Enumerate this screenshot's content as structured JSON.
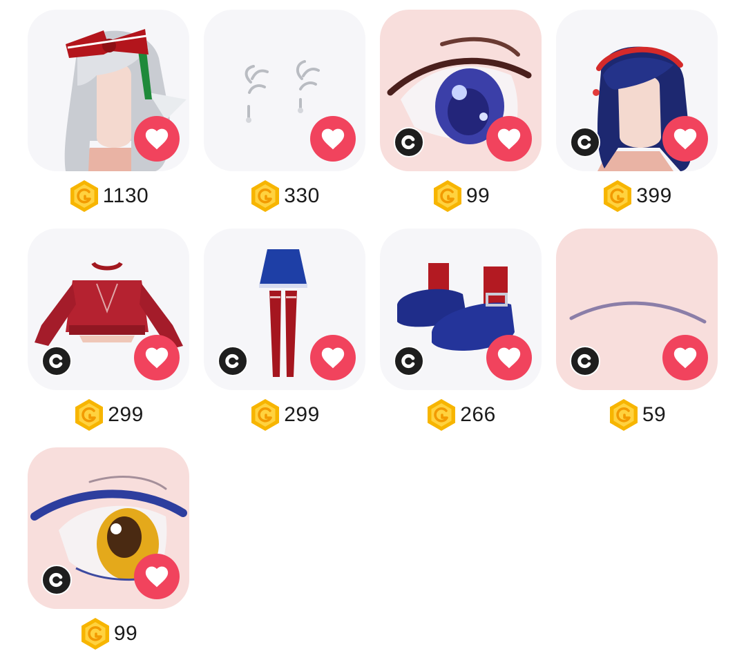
{
  "colors": {
    "heart": "#f1435d",
    "coin": "#f7b500",
    "badge": "#1e1e1e"
  },
  "items": [
    {
      "price": "1130",
      "thumbnail": "white-hair-with-red-bow",
      "creator_badge": false
    },
    {
      "price": "330",
      "thumbnail": "silver-antler-earrings",
      "creator_badge": false
    },
    {
      "price": "99",
      "thumbnail": "blue-eye",
      "creator_badge": true
    },
    {
      "price": "399",
      "thumbnail": "navy-hair-with-red-headband",
      "creator_badge": true
    },
    {
      "price": "299",
      "thumbnail": "red-crop-sweater",
      "creator_badge": true
    },
    {
      "price": "299",
      "thumbnail": "blue-skirt-red-stockings",
      "creator_badge": true
    },
    {
      "price": "266",
      "thumbnail": "blue-shoes-red-socks",
      "creator_badge": true
    },
    {
      "price": "59",
      "thumbnail": "thin-eyebrow",
      "creator_badge": true
    },
    {
      "price": "99",
      "thumbnail": "golden-eye",
      "creator_badge": true
    }
  ]
}
